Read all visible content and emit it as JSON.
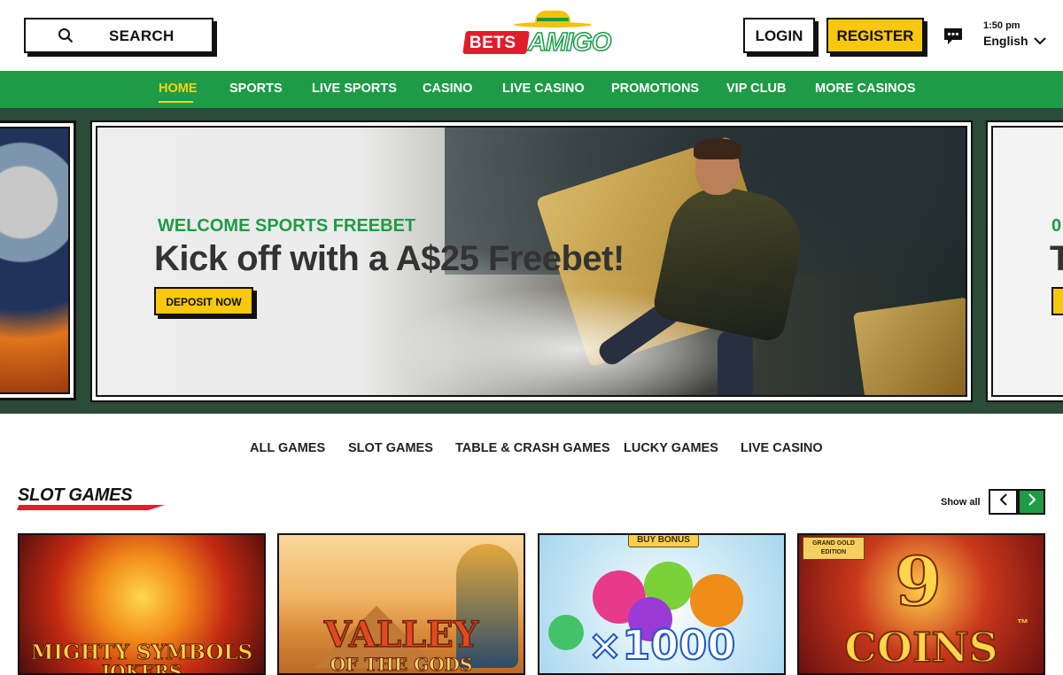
{
  "header": {
    "search_label": "SEARCH",
    "logo_left": "BETS",
    "logo_right": "AMIGO",
    "login_label": "LOGIN",
    "register_label": "REGISTER",
    "time": "1:50 pm",
    "language": "English"
  },
  "nav": {
    "items": [
      {
        "label": "HOME",
        "active": true
      },
      {
        "label": "SPORTS"
      },
      {
        "label": "LIVE SPORTS"
      },
      {
        "label": "CASINO"
      },
      {
        "label": "LIVE CASINO"
      },
      {
        "label": "PROMOTIONS"
      },
      {
        "label": "VIP CLUB"
      },
      {
        "label": "MORE CASINOS"
      }
    ]
  },
  "hero": {
    "subtitle": "WELCOME SPORTS FREEBET",
    "title": "Kick off with a A$25 Freebet!",
    "cta_label": "DEPOSIT NOW",
    "next_slide_sub": "0",
    "next_slide_title": "T"
  },
  "game_tabs": [
    "ALL GAMES",
    "SLOT GAMES",
    "TABLE & CRASH GAMES",
    "LUCKY GAMES",
    "LIVE CASINO"
  ],
  "slot_section": {
    "title": "SLOT GAMES",
    "show_all": "Show all",
    "games": [
      {
        "name": "MIGHTY SYMBOLS",
        "name_line2": "JOKERS"
      },
      {
        "name": "VALLEY",
        "name_line2": "OF THE GODS"
      },
      {
        "badge": "BUY BONUS",
        "name": "×1000"
      },
      {
        "badge": "GRAND GOLD EDITION",
        "number": "9",
        "name": "COINS",
        "tm": "™"
      }
    ]
  },
  "colors": {
    "brand_green": "#1e9b46",
    "brand_yellow": "#f8c80e",
    "brand_red": "#e11d2b",
    "hero_bg": "#2b4a38"
  }
}
